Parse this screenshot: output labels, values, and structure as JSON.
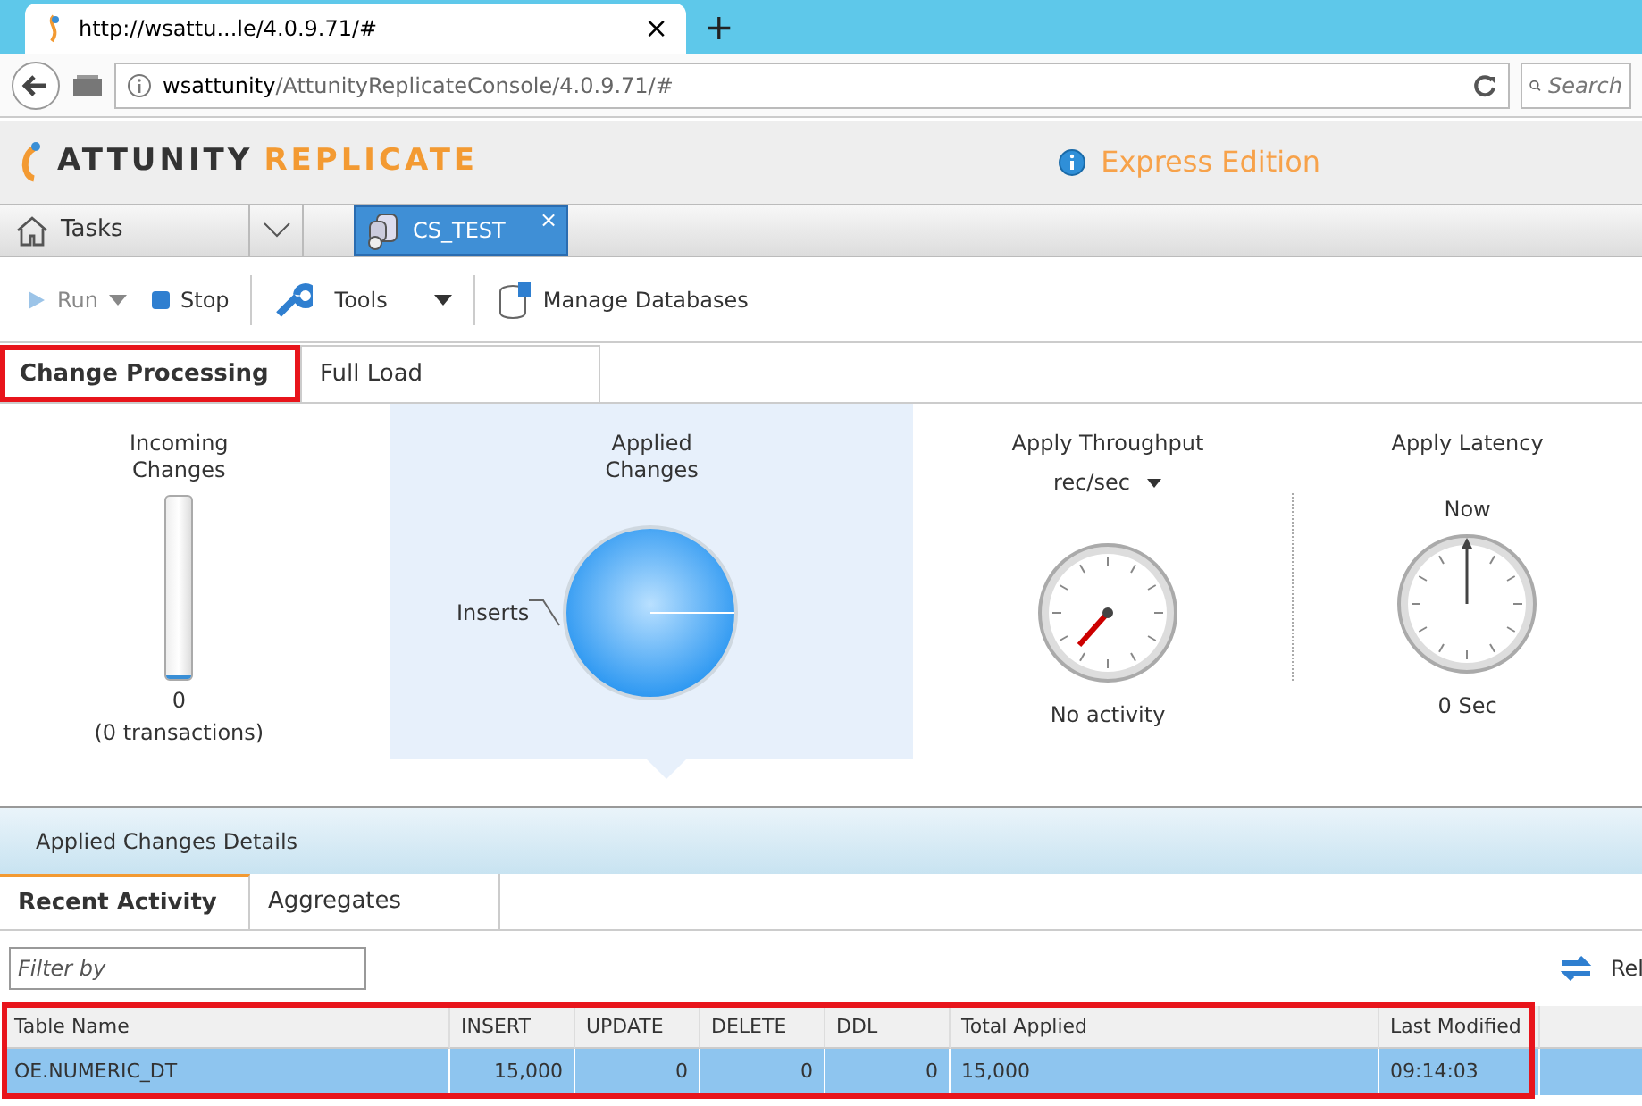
{
  "browser": {
    "tab_title": "http://wsattu...le/4.0.9.71/#",
    "new_tab": "+",
    "close": "×",
    "url_host": "wsattunity",
    "url_path": "/AttunityReplicateConsole/4.0.9.71/#",
    "search_placeholder": "Search"
  },
  "app": {
    "logo_left": "ATTUNITY",
    "logo_right": "REPLICATE",
    "edition": "Express Edition"
  },
  "nav": {
    "home": "Tasks",
    "task_tabs": [
      {
        "label": "CS_TEST",
        "selected": true,
        "close": "×"
      }
    ]
  },
  "toolbar": [
    {
      "kind": "run",
      "label": "Run",
      "disabled": true
    },
    {
      "kind": "stop",
      "label": "Stop",
      "disabled": false
    },
    {
      "kind": "tools",
      "label": "Tools",
      "disabled": false
    },
    {
      "kind": "db",
      "label": "Manage Databases",
      "disabled": false
    }
  ],
  "view_tabs": [
    {
      "label": "Change Processing",
      "selected": true,
      "highlighted": true
    },
    {
      "label": "Full Load",
      "selected": false,
      "highlighted": false
    }
  ],
  "metrics": [
    {
      "kind": "bar",
      "title": "Incoming Changes",
      "level": 0,
      "value": "0",
      "note": "(0 transactions)",
      "selected": false
    },
    {
      "kind": "pie",
      "title": "Applied Changes",
      "slice_label": "Inserts",
      "selected": true
    },
    {
      "kind": "gauge",
      "title": "Apply Throughput",
      "unit": "rec/sec",
      "note": "No activity",
      "selected": false
    },
    {
      "kind": "latency",
      "title": "Apply Latency",
      "dial_label": "Now",
      "note": "0 Sec",
      "selected": false
    }
  ],
  "details": {
    "title": "Applied Changes Details",
    "tabs": [
      {
        "label": "Recent Activity",
        "selected": true
      },
      {
        "label": "Aggregates",
        "selected": false
      }
    ],
    "filter_placeholder": "Filter by",
    "reload": "Rel"
  },
  "table": {
    "highlighted": true,
    "columns": [
      "Table Name",
      "INSERT",
      "UPDATE",
      "DELETE",
      "DDL",
      "Total Applied",
      "Last Modified"
    ],
    "rows": [
      {
        "selected": true,
        "cells": [
          "OE.NUMERIC_DT",
          "15,000",
          "0",
          "0",
          "0",
          "15,000",
          "09:14:03"
        ]
      }
    ]
  }
}
